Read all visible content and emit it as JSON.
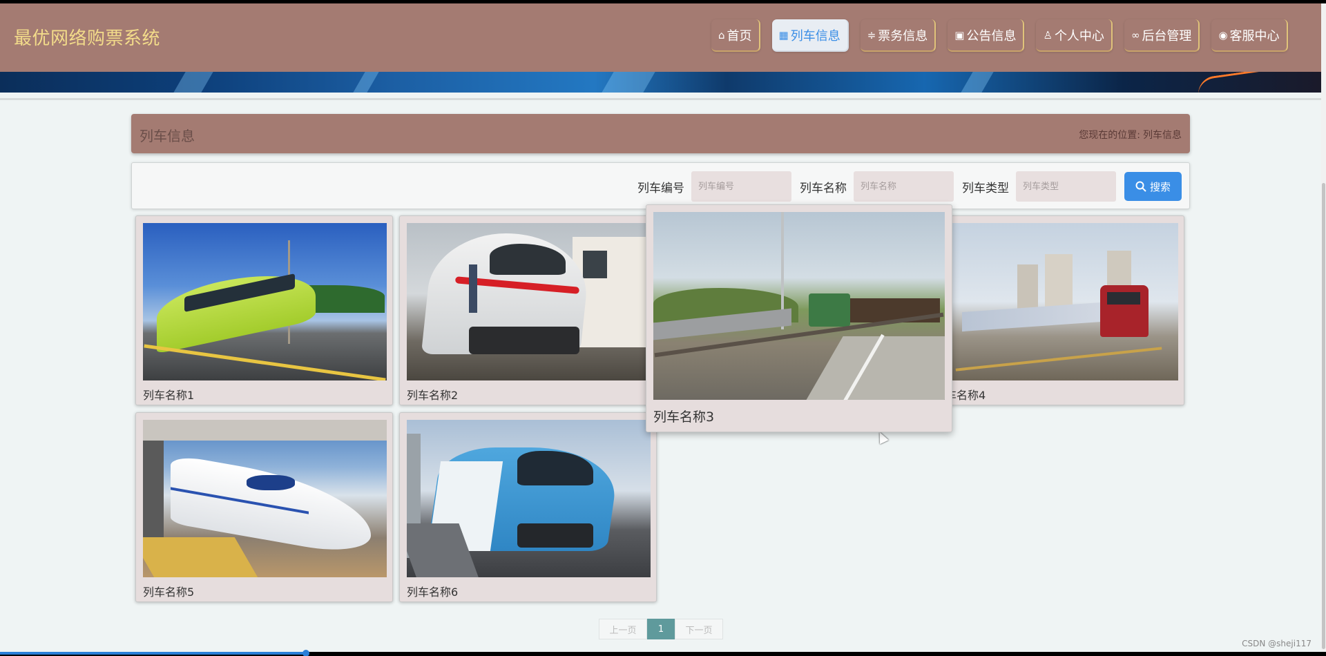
{
  "header": {
    "site_title": "最优网络购票系统",
    "nav": [
      {
        "label": "首页",
        "icon": "home-icon",
        "glyph": "⌂"
      },
      {
        "label": "列车信息",
        "icon": "grid-icon",
        "glyph": "▦"
      },
      {
        "label": "票务信息",
        "icon": "sliders-icon",
        "glyph": "≑"
      },
      {
        "label": "公告信息",
        "icon": "calendar-icon",
        "glyph": "▣"
      },
      {
        "label": "个人中心",
        "icon": "user-icon",
        "glyph": "♙"
      },
      {
        "label": "后台管理",
        "icon": "link-icon",
        "glyph": "∞"
      },
      {
        "label": "客服中心",
        "icon": "chat-icon",
        "glyph": "◉"
      }
    ],
    "active_nav": "列车信息"
  },
  "section": {
    "title": "列车信息",
    "breadcrumb_prefix": "您现在的位置:",
    "breadcrumb_current": "列车信息"
  },
  "search": {
    "fields": [
      {
        "label": "列车编号",
        "placeholder": "列车编号"
      },
      {
        "label": "列车名称",
        "placeholder": "列车名称"
      },
      {
        "label": "列车类型",
        "placeholder": "列车类型"
      }
    ],
    "button_label": "搜索",
    "button_icon": "search-icon"
  },
  "cards": [
    {
      "name": "列车名称1"
    },
    {
      "name": "列车名称2"
    },
    {
      "name": "列车名称3"
    },
    {
      "name": "列车名称4"
    },
    {
      "name": "列车名称5"
    },
    {
      "name": "列车名称6"
    }
  ],
  "pagination": {
    "prev": "上一页",
    "current": "1",
    "next": "下一页"
  },
  "watermark": "CSDN @sheji117",
  "colors": {
    "header": "#a47b72",
    "title": "#f3dc8a",
    "accent": "#3a8ee6",
    "pager_active": "#5f9a9c"
  }
}
